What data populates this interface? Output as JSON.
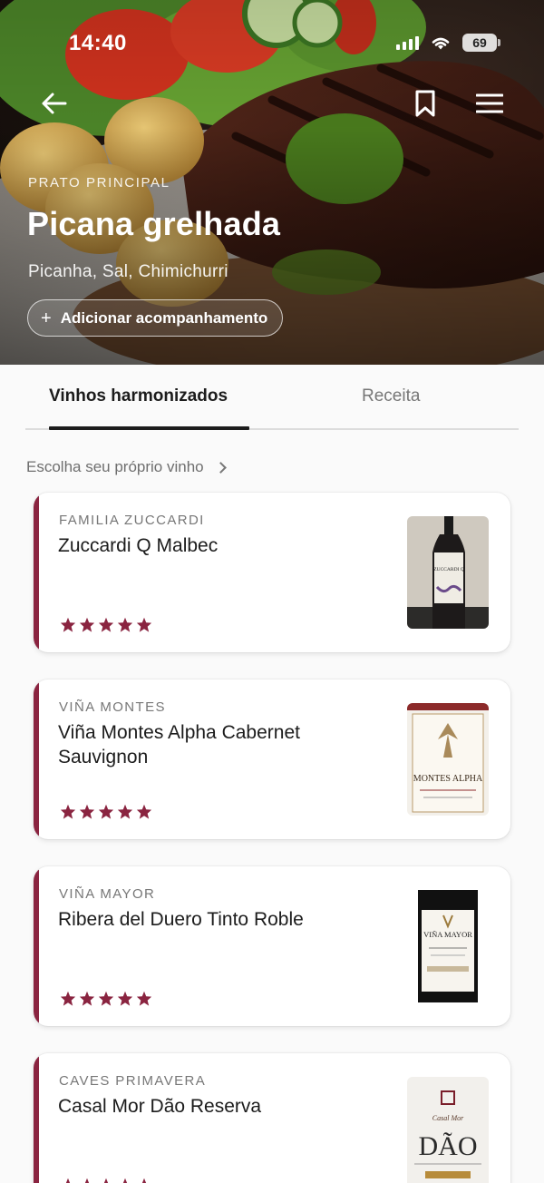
{
  "status_bar": {
    "time": "14:40",
    "battery": "69"
  },
  "hero": {
    "category": "PRATO PRINCIPAL",
    "title": "Picana grelhada",
    "ingredients": "Picanha, Sal, Chimichurri",
    "add_button": "Adicionar acompanhamento",
    "add_icon": "+"
  },
  "tabs": [
    {
      "label": "Vinhos harmonizados",
      "active": true
    },
    {
      "label": "Receita",
      "active": false
    }
  ],
  "choose_link": "Escolha seu próprio vinho",
  "wines": [
    {
      "producer": "FAMILIA ZUCCARDI",
      "name": "Zuccardi Q Malbec",
      "rating": 5,
      "label_text": "ZUCCARDI Q"
    },
    {
      "producer": "VIÑA MONTES",
      "name": "Viña Montes Alpha Cabernet Sauvignon",
      "rating": 5,
      "label_text": "MONTES ALPHA"
    },
    {
      "producer": "VIÑA MAYOR",
      "name": "Ribera del Duero Tinto Roble",
      "rating": 5,
      "label_text": "VIÑA MAYOR"
    },
    {
      "producer": "CAVES PRIMAVERA",
      "name": "Casal Mor Dão Reserva",
      "rating": 5,
      "label_text": "DÃO"
    }
  ],
  "colors": {
    "accent": "#8a2440",
    "star": "#8a2440"
  }
}
